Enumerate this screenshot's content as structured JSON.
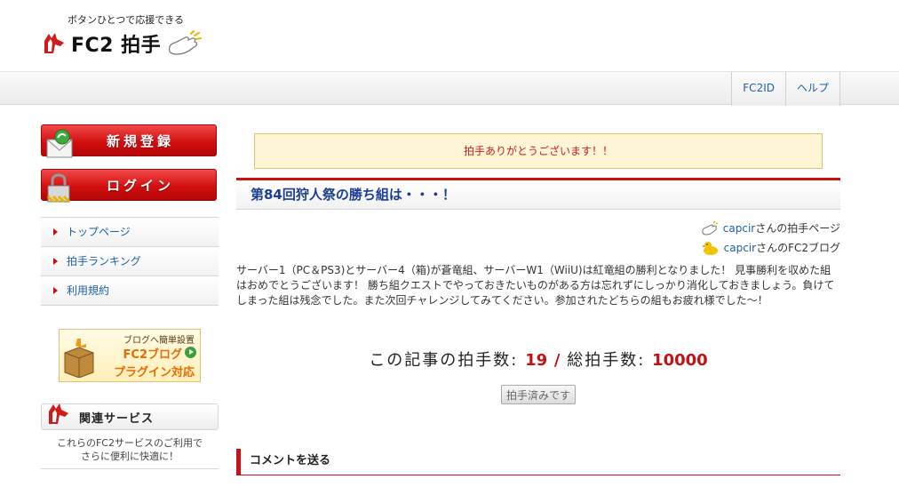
{
  "header": {
    "tagline": "ボタンひとつで応援できる",
    "logo_text": "FC2 拍手"
  },
  "nav": {
    "items": [
      {
        "label": "FC2ID"
      },
      {
        "label": "ヘルプ"
      }
    ]
  },
  "sidebar": {
    "register_label": "新規登録",
    "login_label": "ログイン",
    "menu": [
      {
        "label": "トップページ"
      },
      {
        "label": "拍手ランキング"
      },
      {
        "label": "利用規約"
      }
    ],
    "banner": {
      "line1": "ブログへ簡単設置",
      "line2": "FC2ブログ",
      "line3": "プラグイン対応"
    },
    "related": {
      "title": "関連サービス",
      "desc_line1": "これらのFC2サービスのご利用で",
      "desc_line2": "さらに便利に快適に！"
    }
  },
  "main": {
    "thanks_message": "拍手ありがとうございます！！",
    "article_title": "第84回狩人祭の勝ち組は・・・！",
    "links": [
      {
        "user": "capcir",
        "suffix": "さんの拍手ページ",
        "icon": "clap-hand-icon"
      },
      {
        "user": "capcir",
        "suffix": "さんのFC2ブログ",
        "icon": "duck-icon"
      }
    ],
    "body": "サーバー1（PC＆PS3)とサーバー4（箱)が蒼竜組、サーバーW1（WiiU)は紅竜組の勝利となりました！ 見事勝利を収めた組はおめでとうございます！ 勝ち組クエストでやっておきたいものがある方は忘れずにしっかり消化しておきましょう。負けてしまった組は残念でした。また次回チャレンジしてみてください。参加されたどちらの組もお疲れ様でした～！",
    "counts": {
      "article_label": "この記事の拍手数:",
      "article_count": "19",
      "separator": "/",
      "total_label": "総拍手数:",
      "total_count": "10000"
    },
    "done_button": "拍手済みです",
    "comment_heading": "コメントを送る"
  },
  "colors": {
    "accent_red": "#cc1111",
    "link_blue": "#1d5fa6",
    "title_blue": "#1a3f8f"
  }
}
